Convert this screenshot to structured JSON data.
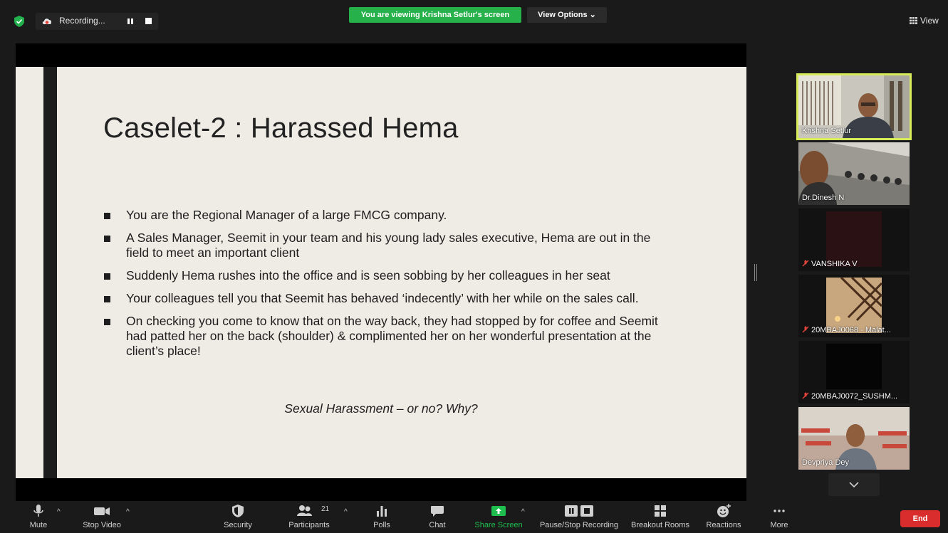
{
  "topbar": {
    "recording_label": "Recording...",
    "viewing_banner": "You are viewing Krishna Setlur's screen",
    "view_options_label": "View Options ⌄",
    "view_label": "View"
  },
  "slide": {
    "title": "Caselet-2 : Harassed Hema",
    "bullets": [
      "You are the Regional Manager of a large FMCG company.",
      " A Sales Manager, Seemit in your team and his young lady sales executive, Hema are out in the field to meet an important client",
      "Suddenly Hema rushes into the office and is seen sobbing by her colleagues in her seat",
      "Your colleagues tell you that Seemit has behaved ‘indecently’ with her while on the sales call.",
      "On checking you come to know that on the way back, they had stopped by for coffee and Seemit had patted her on the back (shoulder) & complimented her on her wonderful presentation at the client’s place!"
    ],
    "question": "Sexual Harassment – or no? Why?"
  },
  "gallery": {
    "participants": [
      {
        "name": "Krishna Setlur",
        "muted": false,
        "active": true
      },
      {
        "name": "Dr.Dinesh N",
        "muted": false,
        "active": false
      },
      {
        "name": "VANSHIKA V",
        "muted": true,
        "active": false
      },
      {
        "name": "20MBAJ0068 - Malat...",
        "muted": true,
        "active": false
      },
      {
        "name": "20MBAJ0072_SUSHM...",
        "muted": true,
        "active": false
      },
      {
        "name": "Devpriya Dey",
        "muted": false,
        "active": false
      }
    ]
  },
  "toolbar": {
    "mute": "Mute",
    "stop_video": "Stop Video",
    "security": "Security",
    "participants": "Participants",
    "participants_count": "21",
    "polls": "Polls",
    "chat": "Chat",
    "share_screen": "Share Screen",
    "pause_recording": "Pause/Stop Recording",
    "breakout_rooms": "Breakout Rooms",
    "reactions": "Reactions",
    "more": "More",
    "end": "End"
  },
  "colors": {
    "accent_green": "#26b14a",
    "share_green": "#1fbf4f",
    "end_red": "#d92c2c",
    "active_speaker": "#d7ea57"
  }
}
